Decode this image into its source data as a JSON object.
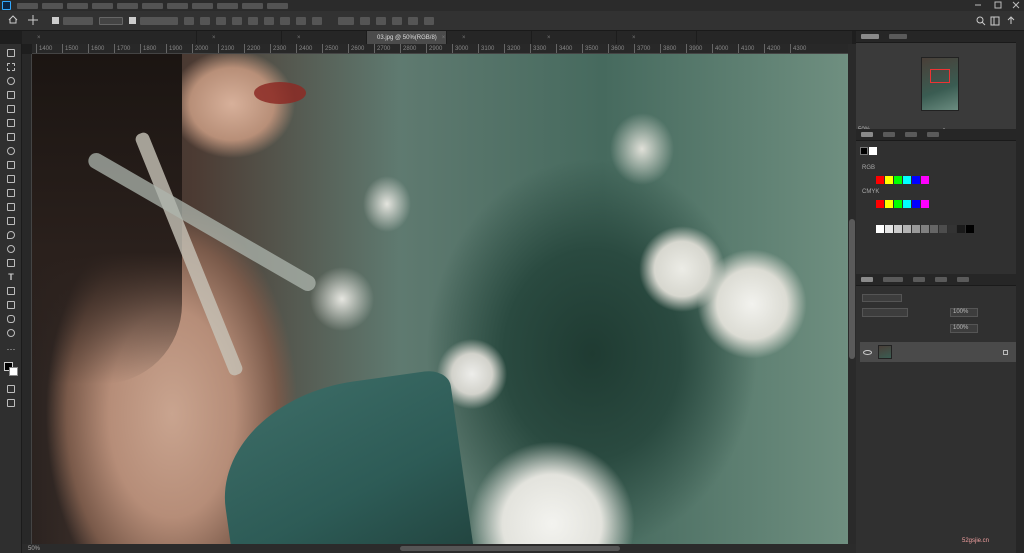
{
  "menubar": {
    "items": [
      "",
      "",
      "",
      "",
      "",
      "",
      "",
      "",
      "",
      "",
      ""
    ]
  },
  "options_bar": {
    "auto_select_label": "",
    "layer_select_value": "",
    "show_transform_label": ""
  },
  "tabs": [
    {
      "label": "",
      "active": false
    },
    {
      "label": "",
      "active": false
    },
    {
      "label": "",
      "active": false
    },
    {
      "label": "03.jpg @ 50%(RGB/8)",
      "active": true
    },
    {
      "label": "",
      "active": false
    },
    {
      "label": "",
      "active": false
    },
    {
      "label": "",
      "active": false
    }
  ],
  "ruler": {
    "ticks": [
      "1400",
      "1500",
      "1600",
      "1700",
      "1800",
      "1900",
      "2000",
      "2100",
      "2200",
      "2300",
      "2400",
      "2500",
      "2600",
      "2700",
      "2800",
      "2900",
      "3000",
      "3100",
      "3200",
      "3300",
      "3400",
      "3500",
      "3600",
      "3700",
      "3800",
      "3900",
      "4000",
      "4100",
      "4200",
      "4300"
    ]
  },
  "status_bar": {
    "zoom": "50%",
    "doc_info": ""
  },
  "panels": {
    "navigator": {
      "zoom": "50%"
    },
    "swatches": {
      "groups": [
        "RGB",
        "CMYK",
        "",
        ""
      ],
      "colors": [
        "#ff0000",
        "#ffff00",
        "#00ff00",
        "#00ffff",
        "#0000ff",
        "#ff00ff"
      ],
      "grays": [
        "#ffffff",
        "#e6e6e6",
        "#cccccc",
        "#b3b3b3",
        "#999999",
        "#808080",
        "#666666",
        "#4d4d4d",
        "#333333",
        "#1a1a1a",
        "#000000"
      ]
    },
    "layers": {
      "blend_mode": "",
      "opacity_value": "100%",
      "fill_value": "100%",
      "layer_name": ""
    }
  },
  "watermark": {
    "line1": "",
    "line2": "52gsjie.cn"
  }
}
